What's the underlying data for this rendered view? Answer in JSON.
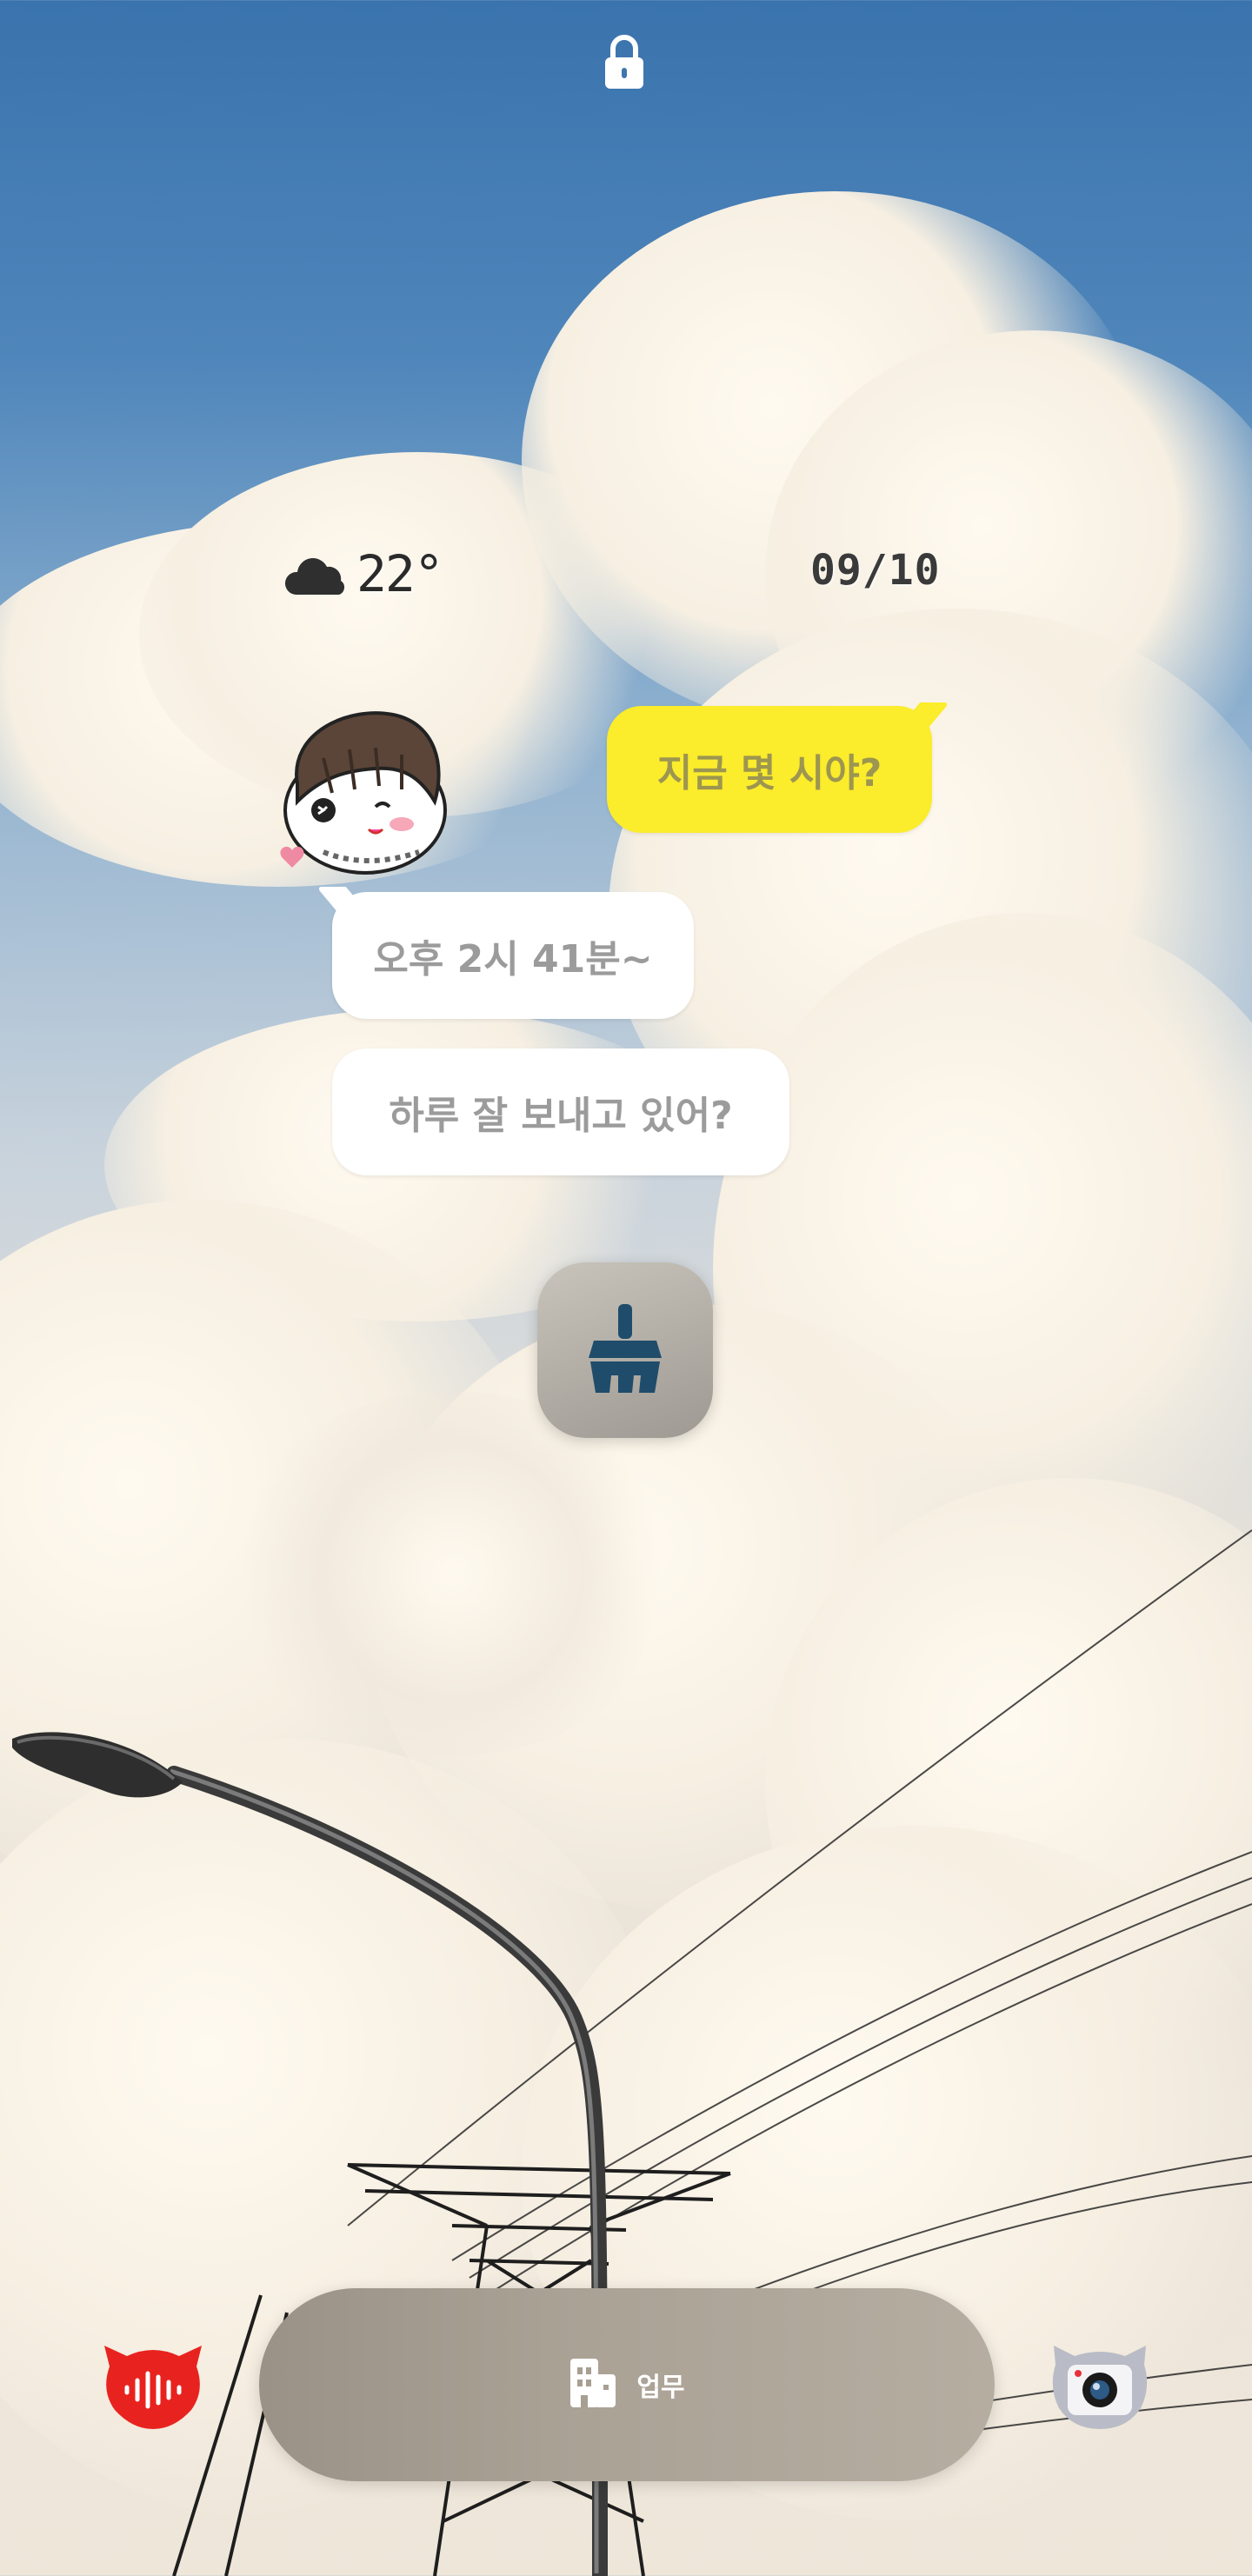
{
  "status": {
    "lock_icon": "lock-icon"
  },
  "weather": {
    "icon": "cloud-icon",
    "temperature": "22°"
  },
  "date": {
    "text": "09/10"
  },
  "chat": {
    "avatar_icon": "character-sticker-avatar",
    "sent_message": "지금 몇 시야?",
    "reply_1": "오후 2시 41분~",
    "reply_2": "하루 잘 보내고 있어?",
    "sent_color": "#fbec2c"
  },
  "widget": {
    "icon": "broom-cleaner-icon",
    "accent": "#1f4c6b"
  },
  "dock": {
    "icon": "building-icon",
    "label": "업무"
  },
  "shortcuts": {
    "left_icon": "voice-recorder-icon",
    "left_color": "#e8231f",
    "right_icon": "camera-icon"
  }
}
